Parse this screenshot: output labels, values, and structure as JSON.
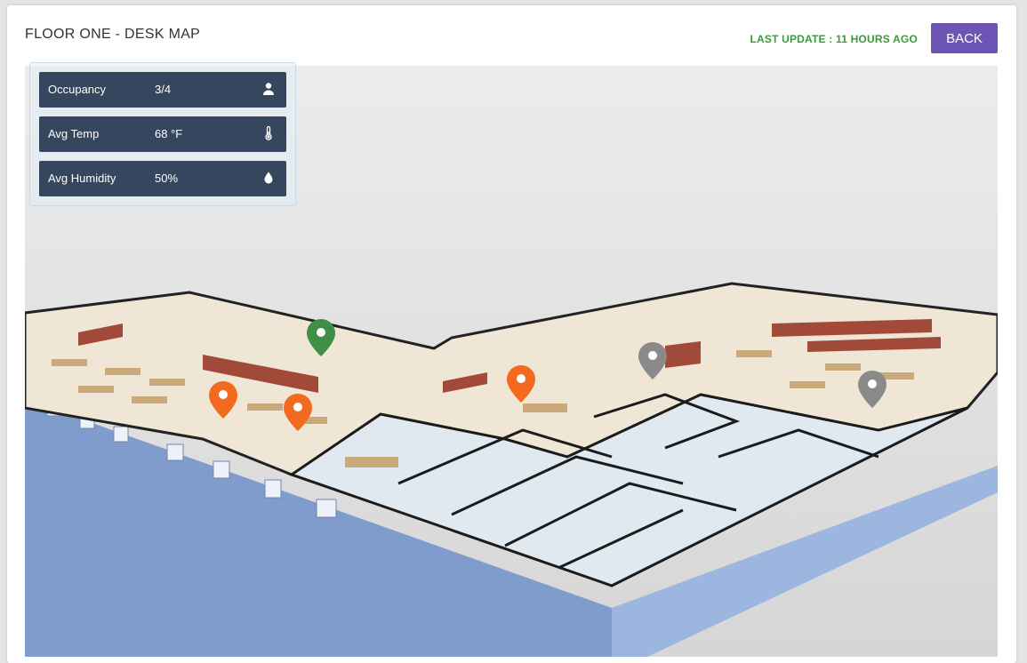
{
  "header": {
    "title": "FLOOR ONE - DESK MAP",
    "last_update": "LAST UPDATE : 11 HOURS AGO",
    "back_label": "BACK"
  },
  "stats": [
    {
      "label": "Occupancy",
      "value": "3/4",
      "icon": "person-icon"
    },
    {
      "label": "Avg Temp",
      "value": "68 °F",
      "icon": "thermometer-icon"
    },
    {
      "label": "Avg Humidity",
      "value": "50%",
      "icon": "droplet-icon"
    }
  ],
  "map": {
    "pin_colors": {
      "occupied": "#f26a1f",
      "available": "#3f8f47",
      "offline": "#8a8a8a"
    },
    "pins": [
      {
        "status": "available"
      },
      {
        "status": "occupied"
      },
      {
        "status": "occupied"
      },
      {
        "status": "occupied"
      },
      {
        "status": "offline"
      },
      {
        "status": "offline"
      }
    ]
  },
  "colors": {
    "accent": "#6c55b4",
    "update_text": "#3a9b3a",
    "stat_bg": "#34475f"
  }
}
